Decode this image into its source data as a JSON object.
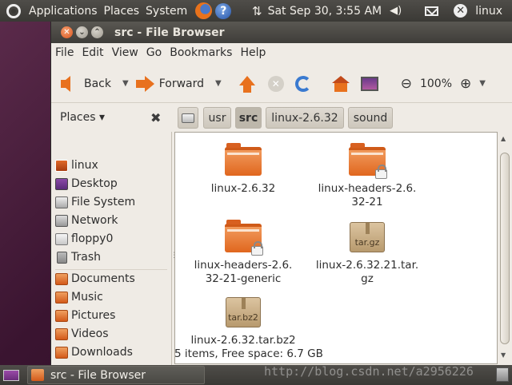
{
  "top_panel": {
    "menus": [
      "Applications",
      "Places",
      "System"
    ],
    "icons": [
      "ubuntu-logo-icon",
      "firefox-icon",
      "help-icon",
      "network-icon",
      "volume-icon",
      "mail-icon",
      "power-icon"
    ],
    "help_glyph": "?",
    "clock": "Sat Sep 30,  3:55 AM",
    "user": "linux"
  },
  "window": {
    "title": "src - File Browser",
    "menu": [
      "File",
      "Edit",
      "View",
      "Go",
      "Bookmarks",
      "Help"
    ],
    "toolbar": {
      "back_label": "Back",
      "forward_label": "Forward",
      "zoom_level": "100%"
    },
    "places_header": "Places ▾",
    "breadcrumbs": [
      "usr",
      "src",
      "linux-2.6.32",
      "sound"
    ],
    "active_crumb": "src",
    "sidebar": {
      "devices": [
        {
          "label": "linux",
          "icon": "home-folder-icon"
        },
        {
          "label": "Desktop",
          "icon": "desktop-icon"
        },
        {
          "label": "File System",
          "icon": "filesystem-icon"
        },
        {
          "label": "Network",
          "icon": "network-icon"
        },
        {
          "label": "floppy0",
          "icon": "floppy-icon"
        },
        {
          "label": "Trash",
          "icon": "trash-icon"
        }
      ],
      "bookmarks": [
        {
          "label": "Documents",
          "icon": "documents-folder-icon"
        },
        {
          "label": "Music",
          "icon": "music-folder-icon"
        },
        {
          "label": "Pictures",
          "icon": "pictures-folder-icon"
        },
        {
          "label": "Videos",
          "icon": "videos-folder-icon"
        },
        {
          "label": "Downloads",
          "icon": "downloads-folder-icon"
        }
      ]
    },
    "files": [
      {
        "name_line1": "linux-2.6.32",
        "name_line2": "",
        "type": "folder",
        "locked": false
      },
      {
        "name_line1": "linux-headers-2.6.",
        "name_line2": "32-21",
        "type": "folder",
        "locked": true
      },
      {
        "name_line1": "linux-headers-2.6.",
        "name_line2": "32-21-generic",
        "type": "folder",
        "locked": true
      },
      {
        "name_line1": "linux-2.6.32.21.tar.",
        "name_line2": "gz",
        "type": "archive",
        "archive_label": "tar.gz"
      },
      {
        "name_line1": "linux-2.6.32.tar.bz2",
        "name_line2": "",
        "type": "archive",
        "archive_label": "tar.bz2"
      }
    ],
    "status": "5 items, Free space: 6.7 GB"
  },
  "bottom_panel": {
    "task_title": "src - File Browser",
    "watermark": "http://blog.csdn.net/a2956226"
  },
  "colors": {
    "accent_orange": "#e8711e",
    "panel_dark": "#3a3935",
    "window_bg": "#efebe5"
  }
}
